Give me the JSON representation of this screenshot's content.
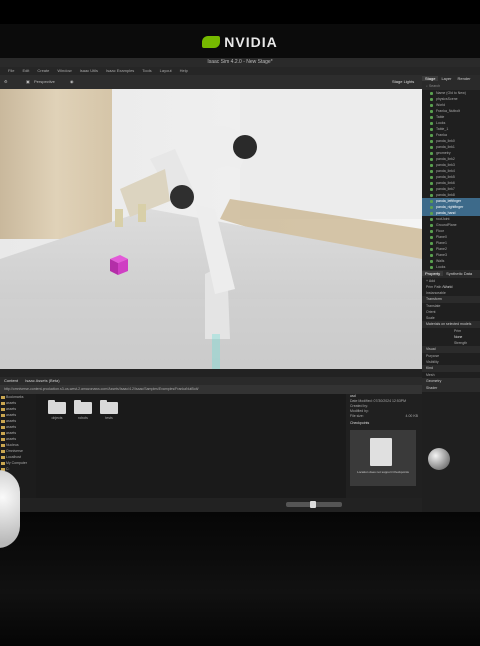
{
  "brand": {
    "name": "NVIDIA"
  },
  "app": {
    "title": "Isaac Sim 4.2.0 - New Stage*"
  },
  "menu": [
    "File",
    "Edit",
    "Create",
    "Window",
    "Isaac Utils",
    "Isaac Examples",
    "Tools",
    "Layout",
    "Help"
  ],
  "viewport_toolbar": {
    "camera": "Perspective",
    "lights": "Stage Lights"
  },
  "content": {
    "tabs": [
      "Content",
      "Isaac Assets (Beta)"
    ],
    "path": "http://omniverse-content-production.s3-us-west-2.amazonaws.com/Assets/Isaac/4.2/Isaac/Samples/Examples/FrankaNutBolt/",
    "tree": [
      "Bookmarks",
      "assets",
      "assets",
      "assets",
      "assets",
      "assets",
      "assets",
      "assets",
      "Nucleus",
      "Omniverse",
      "Localhost",
      "My Computer",
      "C:",
      "D:",
      "E:"
    ],
    "folders": [
      "objects",
      "robots",
      "tests"
    ],
    "info": {
      "name": "usd",
      "date_modified": "Date Modified: 07/30/2024 12:53PM",
      "created_by": "Created by:",
      "modified_by": "Modified by:",
      "file_size": "File size:",
      "size_value": "4.00 KB",
      "checkpoints": "Checkpoints",
      "ckpt_note": "Location does not support Checkpoints"
    }
  },
  "right": {
    "tabs": [
      "Stage",
      "Layer",
      "Render"
    ],
    "search": "Search",
    "stage_items": [
      "Name (Old to New)",
      "physicsScene",
      "World",
      "Franka_Nutbolt",
      "Table",
      "Looks",
      "Table_1",
      "Franka",
      "panda_link0",
      "panda_link1",
      "geometry",
      "panda_link2",
      "panda_link3",
      "panda_link4",
      "panda_link5",
      "panda_link6",
      "panda_link7",
      "panda_link8",
      "panda_leftfinger",
      "panda_rightfinger",
      "panda_hand",
      "rootJoint",
      "GroundPlane",
      "Floor",
      "Plane0",
      "Plane1",
      "Plane2",
      "Plane3",
      "Walls",
      "Looks"
    ],
    "props_tabs": [
      "Property",
      "Synthetic Data"
    ],
    "props": {
      "add": "Add",
      "path": "/World/Franka_Nutbolt",
      "prim_path_label": "Prim Path",
      "prim_path": "/World",
      "instanceable": "Instanceable",
      "transform": "Transform",
      "translate": "Translate",
      "orient": "Orient",
      "scale": "Scale",
      "material": "Materials on selected models",
      "prim": "Prim",
      "none": "None",
      "strength": "Strength",
      "visual": "Visual",
      "purpose": "Purpose",
      "visibility": "Visibility",
      "kind": "Kind",
      "mesh": "Mesh",
      "geometry": "Geometry",
      "shader": "Shader"
    }
  }
}
